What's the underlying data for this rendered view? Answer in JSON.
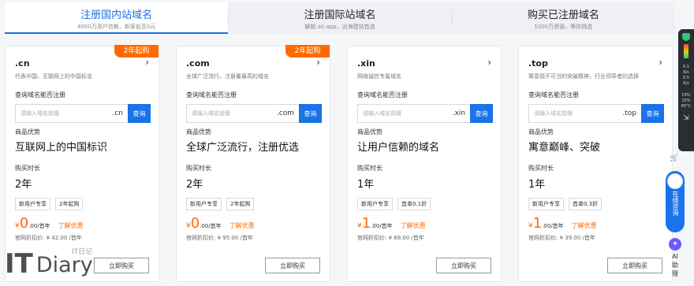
{
  "tabs": [
    {
      "title": "注册国内站域名",
      "sub": "4000万用户信赖，新客低至0元"
    },
    {
      "title": "注册国际站域名",
      "sub": "解锁.ai/.app，出海建站首选"
    },
    {
      "title": "购买已注册域名",
      "sub": "1000万资源，等你挑选"
    }
  ],
  "common": {
    "query_label": "查询域名能否注册",
    "placeholder": "请输入域名前缀",
    "search_btn": "查询",
    "adv_label": "商品优势",
    "dur_label": "购买时长",
    "currency": "¥",
    "price_unit": "/首年",
    "more_link": "了解优惠",
    "buy_btn": "立即购买"
  },
  "cards": [
    {
      "name": ".cn",
      "badge": "2年起购",
      "desc": "代表中国、互联网上的中国标志",
      "suffix": ".cn",
      "adv": "互联网上的中国标识",
      "duration": "2年",
      "tags": [
        "新用户专享",
        "2年起购"
      ],
      "price_int": "0",
      "price_dec": ".00",
      "orig": "官网折扣价: ¥ 42.00 /首年"
    },
    {
      "name": ".com",
      "badge": "2年起购",
      "desc": "全球广泛流行，注册量最高的域名",
      "suffix": ".com",
      "adv": "全球广泛流行，注册优选",
      "duration": "2年",
      "tags": [
        "新用户专享",
        "2年起购"
      ],
      "price_int": "0",
      "price_dec": ".00",
      "orig": "官网折扣价: ¥ 95.00 /首年"
    },
    {
      "name": ".xin",
      "badge": "",
      "desc": "网络诚信专属域名",
      "suffix": ".xin",
      "adv": "让用户信赖的域名",
      "duration": "1年",
      "tags": [
        "新用户专享",
        "首单0.1折"
      ],
      "price_int": "1",
      "price_dec": ".00",
      "orig": "官网折扣价: ¥ 88.00 /首年"
    },
    {
      "name": ".top",
      "badge": "",
      "desc": "寓意锐不可当的突破精神，行业领导者的选择",
      "suffix": ".top",
      "adv": "寓意巅峰、突破",
      "duration": "1年",
      "tags": [
        "新用户专享",
        "首单0.3折"
      ],
      "price_int": "1",
      "price_dec": ".00",
      "orig": "官网折扣价: ¥ 39.00 /首年"
    }
  ],
  "rail": {
    "stats": [
      "0.1",
      "K/s",
      "0.5",
      "K/s",
      "CPU",
      "15%",
      "65°C"
    ]
  },
  "consult": "在线咨询",
  "ai": "AI助理",
  "watermark": {
    "logo": "IT",
    "logo2": "Diary",
    "small": "IT日记"
  }
}
